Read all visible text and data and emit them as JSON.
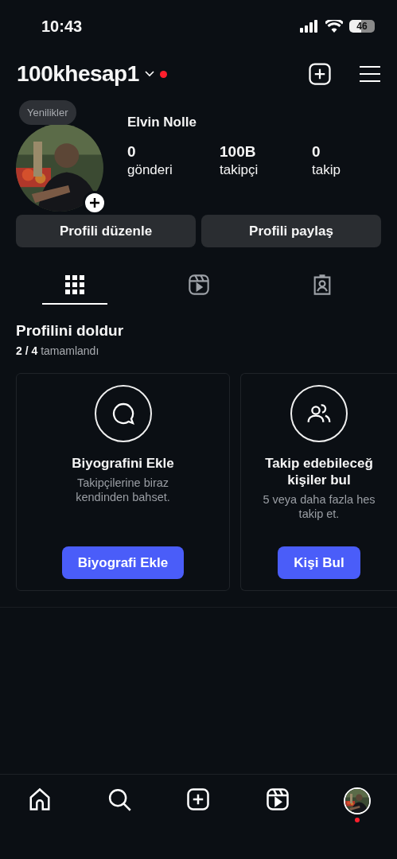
{
  "status_bar": {
    "time": "10:43",
    "battery": "46"
  },
  "header": {
    "username": "100khesap1",
    "has_notification": true
  },
  "profile": {
    "note": "Yenilikler",
    "name": "Elvin Nolle",
    "stats": [
      {
        "value": "0",
        "label": "gönderi"
      },
      {
        "value": "100B",
        "label": "takipçi"
      },
      {
        "value": "0",
        "label": "takip"
      }
    ]
  },
  "buttons": [
    "Profili düzenle",
    "Profili paylaş"
  ],
  "tabs": [
    {
      "kind": "grid",
      "selected": true
    },
    {
      "kind": "reels",
      "selected": false
    },
    {
      "kind": "tagged",
      "selected": false
    }
  ],
  "complete_profile": {
    "title": "Profilini doldur",
    "progress": "**2 / 4** tamamlandı",
    "cards": [
      {
        "kind": "bio",
        "title": "Biyografini Ekle",
        "text": "Takipçilerine biraz kendinden bahset.",
        "button": "Biyografi Ekle"
      },
      {
        "kind": "people",
        "title": "Takip edebileceğ kişiler bul",
        "text": "5 veya daha fazla hes takip et.",
        "button": "Kişi Bul"
      }
    ]
  },
  "bottom_nav": [
    {
      "kind": "home"
    },
    {
      "kind": "search"
    },
    {
      "kind": "create"
    },
    {
      "kind": "reels"
    },
    {
      "kind": "profile",
      "has_notification": true
    }
  ]
}
